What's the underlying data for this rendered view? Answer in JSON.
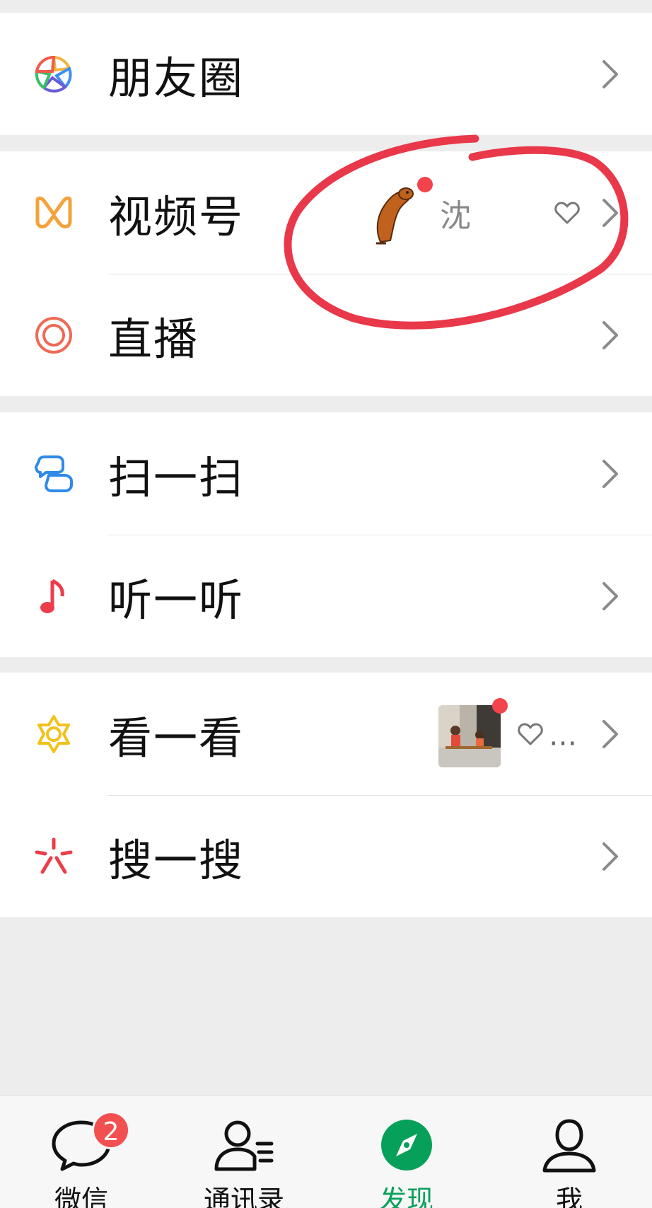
{
  "menu": {
    "moments": {
      "label": "朋友圈",
      "icon": "moments-aperture-icon"
    },
    "channels": {
      "label": "视频号",
      "icon": "channels-icon",
      "preview_name": "沈",
      "preview_avatar": "dog-avatar-icon"
    },
    "live": {
      "label": "直播",
      "icon": "live-icon"
    },
    "scan": {
      "label": "扫一扫",
      "icon": "scan-icon"
    },
    "listen": {
      "label": "听一听",
      "icon": "music-note-icon"
    },
    "top_stories": {
      "label": "看一看",
      "icon": "top-stories-icon",
      "more": "…"
    },
    "search": {
      "label": "搜一搜",
      "icon": "search-star-icon"
    }
  },
  "tabbar": {
    "chats": {
      "label": "微信",
      "badge": "2"
    },
    "contacts": {
      "label": "通讯录"
    },
    "discover": {
      "label": "发现"
    },
    "me": {
      "label": "我"
    }
  },
  "colors": {
    "accent": "#07a05a",
    "badge": "#f25050",
    "annotation": "#e8384a",
    "background": "#ededed"
  }
}
